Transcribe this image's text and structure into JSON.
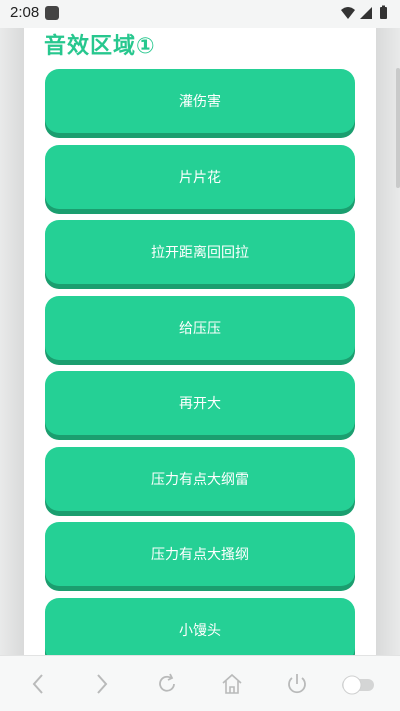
{
  "status_bar": {
    "time": "2:08"
  },
  "section": {
    "title": "音效区域①"
  },
  "buttons": [
    {
      "label": "灌伤害"
    },
    {
      "label": "片片花"
    },
    {
      "label": "拉开距离回回拉"
    },
    {
      "label": "给压压"
    },
    {
      "label": "再开大"
    },
    {
      "label": "压力有点大纲雷"
    },
    {
      "label": "压力有点大搔纲"
    },
    {
      "label": "小馒头"
    }
  ],
  "colors": {
    "accent": "#25d095",
    "accent_shadow": "#1b9e6f",
    "title": "#27c78e"
  },
  "bottom_nav": {
    "icons": [
      "back-icon",
      "forward-icon",
      "refresh-icon",
      "home-icon",
      "power-icon",
      "toggle-icon"
    ]
  }
}
